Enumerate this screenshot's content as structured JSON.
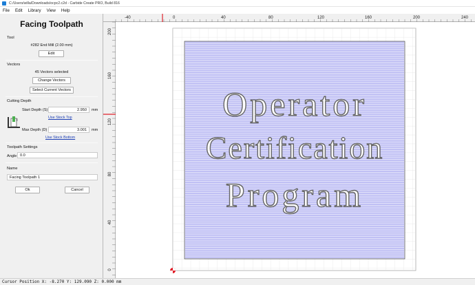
{
  "window": {
    "title": "C:/Users/willa/Downloads/ocpc2.c2d - Carbide Create PRO, Build 816"
  },
  "menu": [
    "File",
    "Edit",
    "Library",
    "View",
    "Help"
  ],
  "panel": {
    "title": "Facing Toolpath",
    "tool": {
      "section": "Tool",
      "name": "#282 End Mill (2.00 mm)",
      "edit_label": "Edit"
    },
    "vectors": {
      "section": "Vectors",
      "count_text": "45 Vectors selected",
      "change_label": "Change Vectors",
      "select_label": "Select Current Vectors"
    },
    "cutting_depth": {
      "section": "Cutting Depth",
      "start_label": "Start Depth (S)",
      "start_value": "2.950",
      "start_unit": "mm",
      "use_top_link": "Use Stock Top",
      "max_label": "Max Depth (D)",
      "max_value": "3.001",
      "max_unit": "mm",
      "use_bottom_link": "Use Stock Bottom"
    },
    "toolpath_settings": {
      "section": "Toolpath Settings",
      "angle_label": "Angle",
      "angle_value": "0.0"
    },
    "name": {
      "section": "Name",
      "value": "Facing Toolpath 1"
    },
    "ok_label": "Ok",
    "cancel_label": "Cancel"
  },
  "canvas": {
    "top_ruler": [
      "-40",
      "0",
      "40",
      "80",
      "120",
      "160",
      "200",
      "240"
    ],
    "left_ruler": [
      "200",
      "160",
      "120",
      "80",
      "40",
      "0"
    ],
    "text_lines": [
      "Operator",
      "Certification",
      "Program"
    ],
    "colors": {
      "toolpath": "#3a3adf",
      "marker": "#e0202a",
      "stock": "#ffffff"
    }
  },
  "status": {
    "cursor": "Cursor Position X: -8.270 Y: 129.090 Z: 0.000 mm"
  }
}
